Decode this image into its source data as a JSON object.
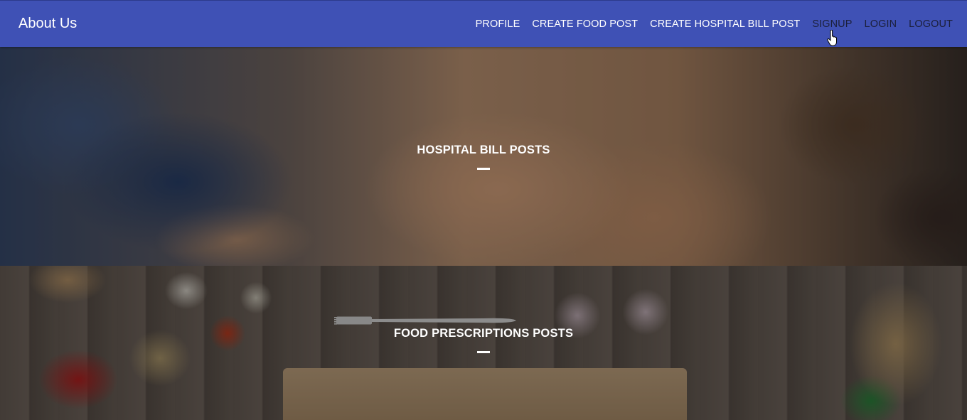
{
  "navbar": {
    "brand": "About Us",
    "links": [
      "PROFILE",
      "CREATE FOOD POST",
      "CREATE HOSPITAL BILL POST",
      "SIGNUP",
      "LOGIN",
      "LOGOUT"
    ]
  },
  "sections": [
    {
      "title": "HOSPITAL BILL POSTS"
    },
    {
      "title": "FOOD PRESCRIPTIONS POSTS"
    }
  ],
  "colors": {
    "navbar": "#3f51b5",
    "nav_text": "#ffffff",
    "nav_text_hover": "#1b1f3a"
  },
  "icons": {
    "cursor": "hand-pointer-icon"
  }
}
